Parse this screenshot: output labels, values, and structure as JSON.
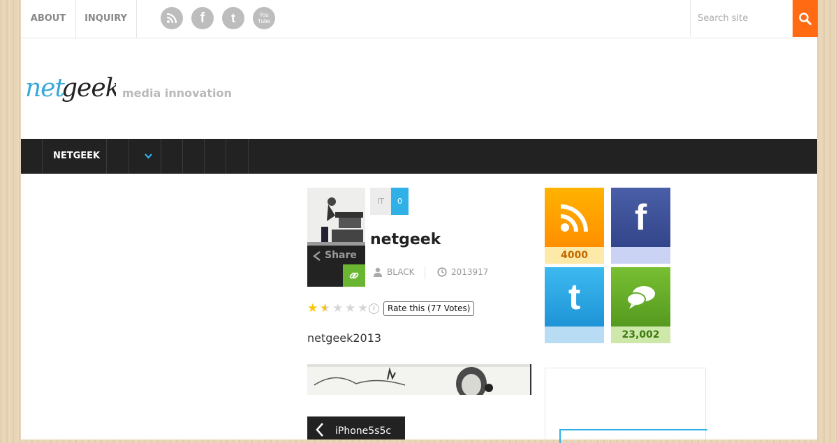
{
  "topbar": {
    "links": [
      "ABOUT",
      "INQUIRY"
    ],
    "social_icons": [
      "rss-icon",
      "facebook-icon",
      "twitter-icon",
      "youtube-icon"
    ],
    "youtube_text": "You Tube",
    "search_placeholder": "Search site"
  },
  "header": {
    "logo_text": "netgeek",
    "tagline": "media innovation"
  },
  "nav": {
    "items": [
      {
        "label": "NETGEEK"
      }
    ]
  },
  "post": {
    "category": "IT",
    "comment_count": "0",
    "title": "netgeek",
    "author": "BLACK",
    "date": "2013917",
    "share_label": "Share",
    "rating": {
      "stars_filled": 1.5,
      "stars_total": 5,
      "label": "Rate this (77 Votes)"
    },
    "excerpt": "netgeek2013"
  },
  "prev_post": {
    "label": "iPhone5s5c"
  },
  "sidebar": {
    "tiles": [
      {
        "icon": "rss-icon",
        "count": "4000",
        "color": "#ff9f00",
        "bottom_color": "#fde9a8",
        "text_color": "#c46a00"
      },
      {
        "icon": "facebook-icon",
        "count": "",
        "color": "#3b4f99",
        "bottom_color": "#cbd3f5",
        "text_color": "#3b4f99"
      },
      {
        "icon": "twitter-icon",
        "count": "",
        "color": "#2fa7e2",
        "bottom_color": "#b8dcf4",
        "text_color": "#1c7fb5"
      },
      {
        "icon": "comments-icon",
        "count": "23,002",
        "color": "#66ad2a",
        "bottom_color": "#cde8a8",
        "text_color": "#3f7a12"
      }
    ]
  },
  "colors": {
    "accent_orange": "#ff6a13",
    "accent_blue": "#2fb1e8",
    "accent_green": "#6bb630",
    "nav_bg": "#222222"
  }
}
